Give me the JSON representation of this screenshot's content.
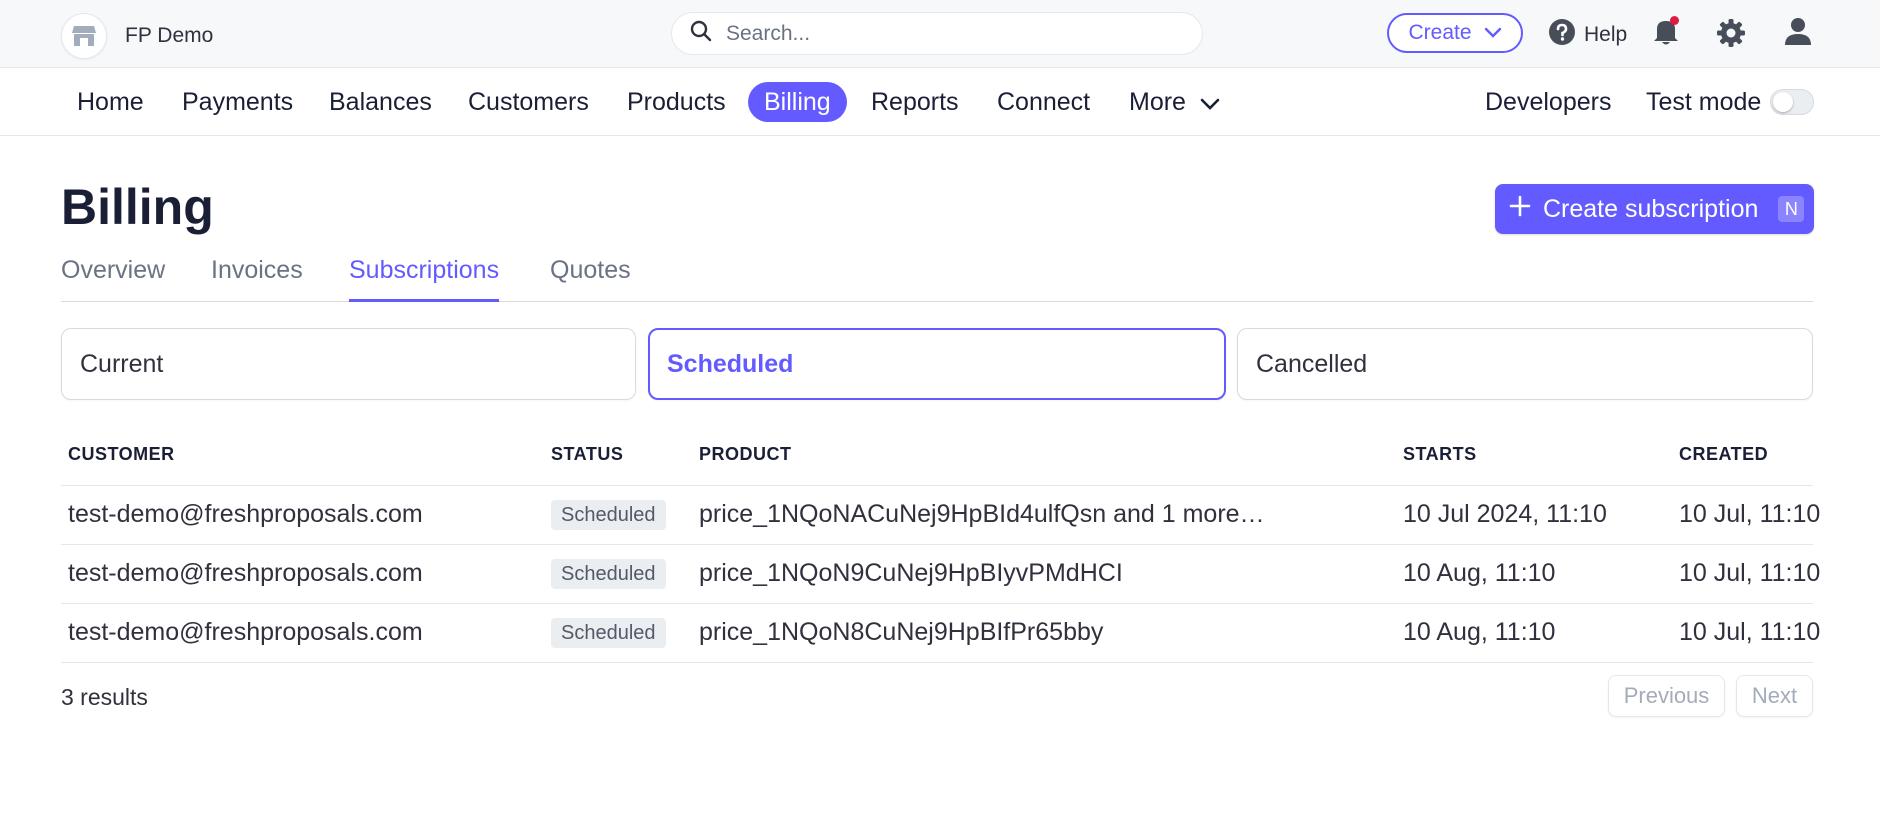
{
  "topbar": {
    "account_name": "FP Demo",
    "search_placeholder": "Search...",
    "create_label": "Create",
    "help_label": "Help"
  },
  "nav": {
    "items": [
      {
        "label": "Home"
      },
      {
        "label": "Payments"
      },
      {
        "label": "Balances"
      },
      {
        "label": "Customers"
      },
      {
        "label": "Products"
      },
      {
        "label": "Billing"
      },
      {
        "label": "Reports"
      },
      {
        "label": "Connect"
      },
      {
        "label": "More"
      }
    ],
    "active": "Billing",
    "developers_label": "Developers",
    "test_mode_label": "Test mode",
    "test_mode_on": false
  },
  "page": {
    "title": "Billing",
    "create_button_label": "Create subscription",
    "create_button_shortcut": "N"
  },
  "tabs": [
    {
      "label": "Overview"
    },
    {
      "label": "Invoices"
    },
    {
      "label": "Subscriptions"
    },
    {
      "label": "Quotes"
    }
  ],
  "active_tab": "Subscriptions",
  "filters": [
    {
      "label": "Current"
    },
    {
      "label": "Scheduled"
    },
    {
      "label": "Cancelled"
    }
  ],
  "active_filter": "Scheduled",
  "table": {
    "headers": [
      "CUSTOMER",
      "STATUS",
      "PRODUCT",
      "STARTS",
      "CREATED"
    ],
    "rows": [
      {
        "customer": "test-demo@freshproposals.com",
        "status": "Scheduled",
        "product": "price_1NQoNACuNej9HpBId4ulfQsn and 1 more…",
        "starts": "10 Jul 2024, 11:10",
        "created": "10 Jul, 11:10"
      },
      {
        "customer": "test-demo@freshproposals.com",
        "status": "Scheduled",
        "product": "price_1NQoN9CuNej9HpBIyvPMdHCI",
        "starts": "10 Aug, 11:10",
        "created": "10 Jul, 11:10"
      },
      {
        "customer": "test-demo@freshproposals.com",
        "status": "Scheduled",
        "product": "price_1NQoN8CuNej9HpBIfPr65bby",
        "starts": "10 Aug, 11:10",
        "created": "10 Jul, 11:10"
      }
    ]
  },
  "footer": {
    "results_text": "3 results",
    "previous_label": "Previous",
    "next_label": "Next"
  },
  "colors": {
    "accent": "#635bff",
    "notification_dot": "#df1b41"
  },
  "icons": {
    "brand": "storefront-icon",
    "search": "search-icon",
    "create_chevron": "chevron-down-icon",
    "help": "help-circle-icon",
    "notifications": "bell-icon",
    "settings": "gear-icon",
    "profile": "user-icon",
    "more_chevron": "chevron-down-icon",
    "create_subscription": "plus-icon"
  }
}
